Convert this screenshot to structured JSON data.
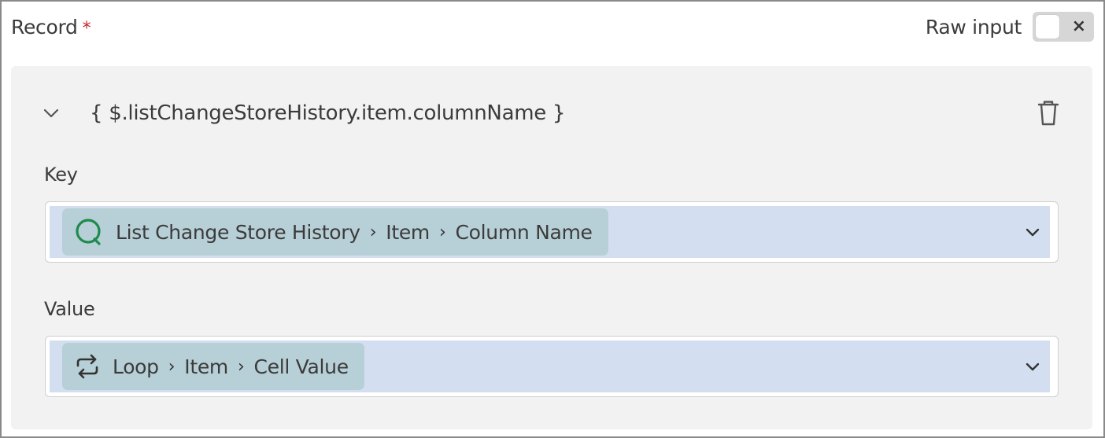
{
  "field": {
    "label": "Record",
    "required_mark": "*"
  },
  "raw_input": {
    "label": "Raw input",
    "close_glyph": "×",
    "enabled": false
  },
  "record": {
    "title": "{ $.listChangeStoreHistory.item.columnName }",
    "key": {
      "label": "Key",
      "icon": "search-icon",
      "path": [
        "List Change Store History",
        "Item",
        "Column Name"
      ]
    },
    "value": {
      "label": "Value",
      "icon": "loop-icon",
      "path": [
        "Loop",
        "Item",
        "Cell Value"
      ]
    }
  },
  "separator": "›",
  "colors": {
    "search_icon": "#1f8a4c",
    "select_fill": "#d3dff0",
    "chip_bg": "#b7cfd6",
    "panel_bg": "#f2f2f2",
    "required": "#c62828"
  }
}
